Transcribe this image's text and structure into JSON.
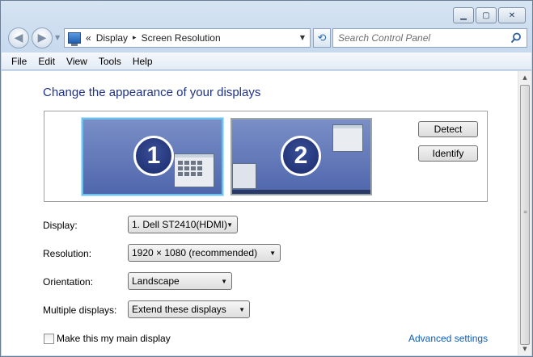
{
  "window": {
    "caption_buttons": [
      "minimize",
      "maximize",
      "close"
    ]
  },
  "address_bar": {
    "chevron": "«",
    "breadcrumbs": [
      "Display",
      "Screen Resolution"
    ],
    "separator": "▸"
  },
  "search": {
    "placeholder": "Search Control Panel"
  },
  "menu": [
    "File",
    "Edit",
    "View",
    "Tools",
    "Help"
  ],
  "main": {
    "title": "Change the appearance of your displays",
    "monitors": [
      {
        "number": "1",
        "selected": true
      },
      {
        "number": "2",
        "selected": false
      }
    ],
    "detect_label": "Detect",
    "identify_label": "Identify",
    "fields": {
      "display": {
        "label": "Display:",
        "value": "1. Dell ST2410(HDMI)"
      },
      "resolution": {
        "label": "Resolution:",
        "value": "1920 × 1080 (recommended)"
      },
      "orientation": {
        "label": "Orientation:",
        "value": "Landscape"
      },
      "multiple": {
        "label": "Multiple displays:",
        "value": "Extend these displays"
      }
    },
    "main_display_label": "Make this my main display",
    "main_display_checked": false,
    "advanced_link": "Advanced settings"
  },
  "colors": {
    "title": "#1e3287",
    "link": "#0b5cbb",
    "selection": "#6ec0ee"
  }
}
